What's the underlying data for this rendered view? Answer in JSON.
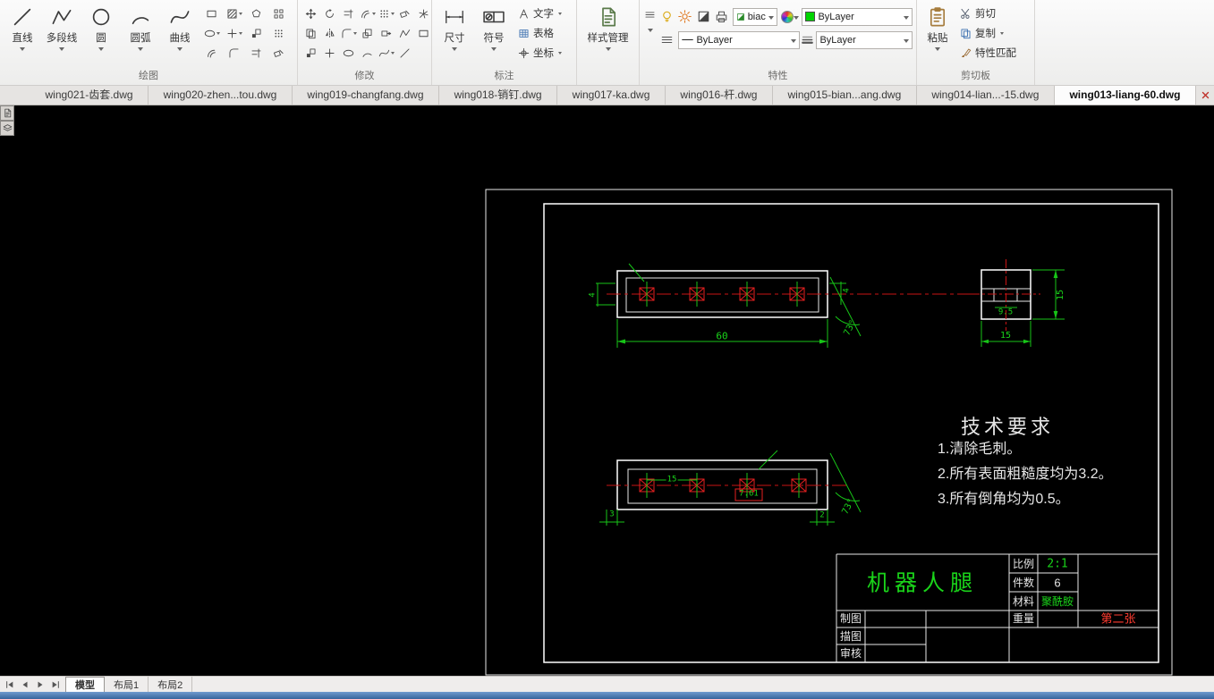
{
  "ribbon": {
    "draw": {
      "label": "绘图",
      "buttons": [
        "直线",
        "多段线",
        "圆",
        "圆弧",
        "曲线"
      ]
    },
    "modify": {
      "label": "修改"
    },
    "annotate": {
      "label": "标注",
      "dimension": "尺寸",
      "symbol": "符号",
      "text": "文字",
      "table": "表格",
      "coordinate": "坐标",
      "style_manager": "样式管理"
    },
    "properties": {
      "label": "特性",
      "plot_style": "biac",
      "layer": "ByLayer",
      "linetype": "ByLayer",
      "lineweight": "ByLayer"
    },
    "clipboard": {
      "label": "剪切板",
      "paste": "粘贴",
      "cut": "剪切",
      "copy": "复制",
      "match_properties": "特性匹配"
    }
  },
  "file_tabs": [
    {
      "label": "wing021-齿套.dwg"
    },
    {
      "label": "wing020-zhen...tou.dwg"
    },
    {
      "label": "wing019-changfang.dwg"
    },
    {
      "label": "wing018-销钉.dwg"
    },
    {
      "label": "wing017-ka.dwg"
    },
    {
      "label": "wing016-杆.dwg"
    },
    {
      "label": "wing015-bian...ang.dwg"
    },
    {
      "label": "wing014-lian...-15.dwg"
    },
    {
      "label": "wing013-liang-60.dwg"
    }
  ],
  "drawing": {
    "tech_requirements": {
      "title": "技术要求",
      "items": [
        "1.清除毛刺。",
        "2.所有表面粗糙度均为3.2。",
        "3.所有倒角均为0.5。"
      ]
    },
    "title_block": {
      "part_name": "机器人腿",
      "scale_label": "比例",
      "scale_value": "2:1",
      "qty_label": "件数",
      "qty_value": "6",
      "material_label": "材料",
      "material_value": "聚酰胺",
      "weight_label": "重量",
      "sheet_note": "第二张",
      "drawn_label": "制图",
      "traced_label": "描图",
      "checked_label": "审核"
    },
    "dimensions": {
      "top_width": "60",
      "top_left": "4",
      "top_right": "4",
      "top_angle": "73°",
      "side_height": "15",
      "side_width": "15",
      "side_slot": "9.5",
      "pitch": "15",
      "tolerance_box": "7.61",
      "bottom_left": "3",
      "bottom_right": "2",
      "bottom_angle": "73°"
    }
  },
  "layout_tabs": [
    {
      "label": "模型"
    },
    {
      "label": "布局1"
    },
    {
      "label": "布局2"
    }
  ]
}
